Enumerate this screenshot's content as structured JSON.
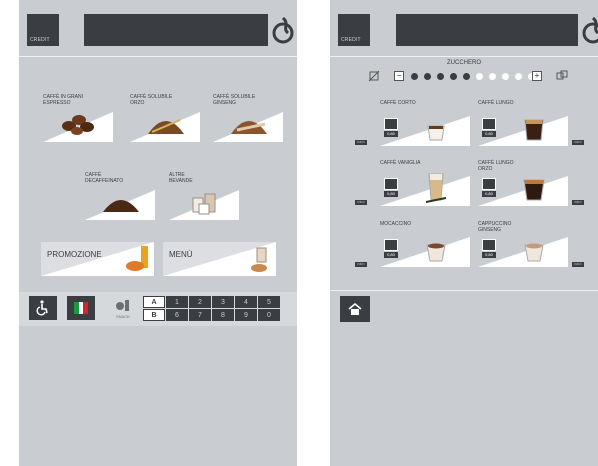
{
  "left": {
    "credit_label": "CREDIT",
    "products": [
      {
        "label": "CAFFÈ IN GRANI\nESPRESSO"
      },
      {
        "label": "CAFFÈ SOLUBILE\nORZO"
      },
      {
        "label": "CAFFÈ SOLUBILE\nGINSENG"
      },
      {
        "label": "CAFFÈ\nDECAFFEINATO"
      },
      {
        "label": "ALTRE\nBEVANDE"
      }
    ],
    "promo_label": "PROMOZIONE",
    "menu_label": "MENÙ",
    "snack_label": "SNACK",
    "letters": [
      "A",
      "B"
    ],
    "row_a": [
      "1",
      "2",
      "3",
      "4",
      "5"
    ],
    "row_b": [
      "6",
      "7",
      "8",
      "9",
      "0"
    ]
  },
  "right": {
    "credit_label": "CREDIT",
    "sugar_label": "ZUCCHERO",
    "sugar_minus": "−",
    "sugar_plus": "+",
    "sugar_filled": 5,
    "sugar_total": 10,
    "info_label": "INFO",
    "price": "0,80",
    "drinks": [
      {
        "label": "CAFFÈ CORTO"
      },
      {
        "label": "CAFFÈ LUNGO"
      },
      {
        "label": "CAFFÈ VANIGLIA"
      },
      {
        "label": "CAFFÈ LUNGO\nORZO"
      },
      {
        "label": "MOCACCINO"
      },
      {
        "label": "CAPPUCCINO\nGINSENG"
      }
    ]
  },
  "colors": {
    "dark": "#3a3d41",
    "panel": "#c9cdd1",
    "accent": "#f2c400"
  }
}
